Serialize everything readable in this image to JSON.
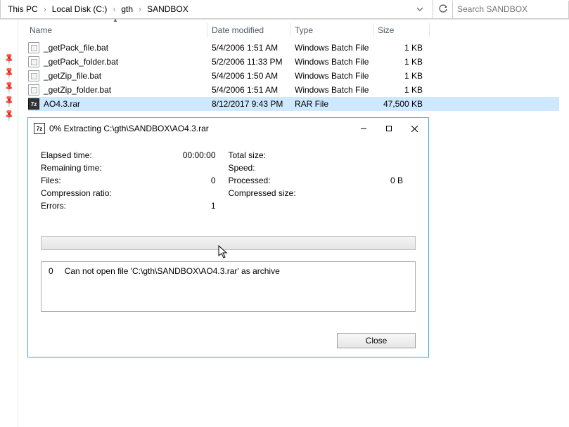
{
  "breadcrumb": {
    "items": [
      "This PC",
      "Local Disk (C:)",
      "gth",
      "SANDBOX"
    ]
  },
  "search": {
    "placeholder": "Search SANDBOX"
  },
  "columns": {
    "name": "Name",
    "date": "Date modified",
    "type": "Type",
    "size": "Size"
  },
  "files": [
    {
      "name": "_getPack_file.bat",
      "date": "5/4/2006 1:51 AM",
      "type": "Windows Batch File",
      "size": "1 KB",
      "icon": "bat",
      "selected": false
    },
    {
      "name": "_getPack_folder.bat",
      "date": "5/2/2006 11:33 PM",
      "type": "Windows Batch File",
      "size": "1 KB",
      "icon": "bat",
      "selected": false
    },
    {
      "name": "_getZip_file.bat",
      "date": "5/4/2006 1:50 AM",
      "type": "Windows Batch File",
      "size": "1 KB",
      "icon": "bat",
      "selected": false
    },
    {
      "name": "_getZip_folder.bat",
      "date": "5/4/2006 1:51 AM",
      "type": "Windows Batch File",
      "size": "1 KB",
      "icon": "bat",
      "selected": false
    },
    {
      "name": "AO4.3.rar",
      "date": "8/12/2017 9:43 PM",
      "type": "RAR File",
      "size": "47,500 KB",
      "icon": "rar",
      "selected": true
    }
  ],
  "dialog": {
    "title": "0% Extracting C:\\gth\\SANDBOX\\AO4.3.rar",
    "stats_left": [
      {
        "label": "Elapsed time:",
        "value": "00:00:00"
      },
      {
        "label": "Remaining time:",
        "value": ""
      },
      {
        "label": "Files:",
        "value": "0"
      },
      {
        "label": "Compression ratio:",
        "value": ""
      },
      {
        "label": "Errors:",
        "value": "1"
      }
    ],
    "stats_right": [
      {
        "label": "Total size:",
        "value": ""
      },
      {
        "label": "Speed:",
        "value": ""
      },
      {
        "label": "Processed:",
        "value": "0 B"
      },
      {
        "label": "Compressed size:",
        "value": ""
      }
    ],
    "log": {
      "col0": "0",
      "msg": "Can not open file 'C:\\gth\\SANDBOX\\AO4.3.rar' as archive"
    },
    "close_label": "Close"
  },
  "icon_text": {
    "rar": "7z",
    "dlg": "7z"
  }
}
